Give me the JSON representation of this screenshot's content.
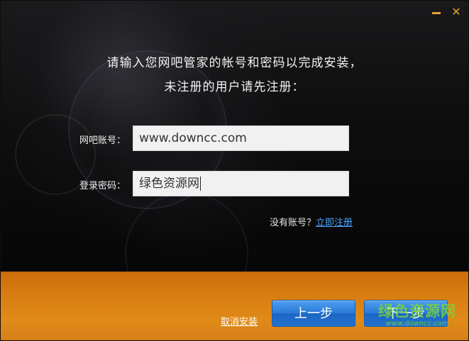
{
  "window": {
    "minimize_icon": "minimize-icon",
    "close_icon": "close-icon",
    "close_glyph": "✕",
    "accent_color": "#e8a126"
  },
  "prompt": {
    "line1": "请输入您网吧管家的帐号和密码以完成安装，",
    "line2": "未注册的用户请先注册："
  },
  "form": {
    "account_label": "网吧账号：",
    "account_value": "www.downcc.com",
    "password_label": "登录密码：",
    "password_value": "绿色资源网"
  },
  "register": {
    "prompt": "没有账号？",
    "link": "立即注册"
  },
  "footer": {
    "cancel_label": "取消安装",
    "prev_label": "上一步",
    "next_label": "下一步",
    "footer_color": "#d97e12",
    "button_color": "#2a7bd8"
  },
  "watermark": {
    "name": "绿色资源网",
    "url": "www.downcc.com"
  }
}
